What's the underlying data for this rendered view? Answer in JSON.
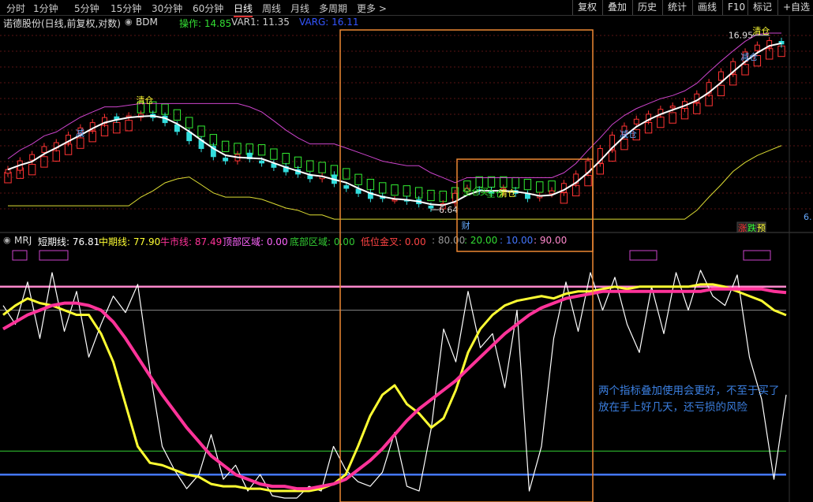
{
  "toolbar": {
    "periods": [
      "分时",
      "1分钟",
      "5分钟",
      "15分钟",
      "30分钟",
      "60分钟",
      "日线",
      "周线",
      "月线",
      "多周期",
      "更多 >"
    ],
    "active": "日线",
    "right_buttons": [
      "复权",
      "叠加",
      "历史",
      "统计",
      "画线",
      "F10",
      "标记",
      "+自选"
    ]
  },
  "main_panel": {
    "title": "诺德股份(日线,前复权,对数)",
    "indicator_name": "BDM",
    "items": [
      {
        "label": "操作: 14.85",
        "color": "#33dd33"
      },
      {
        "label": "VAR1: 11.35",
        "color": "#cccccc"
      },
      {
        "label": "VARG: 16.11",
        "color": "#3355ff"
      }
    ],
    "signal_labels": [
      {
        "text": "减",
        "color": "#66aaff"
      },
      {
        "text": "清仓",
        "color": "#ffff33"
      },
      {
        "text": "全仓买",
        "color": "#33ee33"
      },
      {
        "text": "全仓",
        "color": "#33ee33"
      },
      {
        "text": "清仓",
        "color": "#ffff33"
      },
      {
        "text": "减仓",
        "color": "#66aaff"
      },
      {
        "text": "减仓",
        "color": "#66aaff"
      },
      {
        "text": "清仓",
        "color": "#ffff33"
      }
    ],
    "price_high_label": "16.95",
    "price_low_label": "6.64",
    "event_label": "财",
    "badges": [
      {
        "text": "涨",
        "color": "#ff3333"
      },
      {
        "text": "跌",
        "color": "#33ff33"
      },
      {
        "text": "预",
        "color": "#ffff33"
      }
    ],
    "right_axis_tag": "6."
  },
  "sub_panel": {
    "title": "MRJ",
    "items": [
      {
        "label": "短期线: 76.81",
        "color": "#ffffff"
      },
      {
        "label": "中期线: 77.90",
        "color": "#ffff33"
      },
      {
        "label": "牛市线: 87.49",
        "color": "#ff3399"
      },
      {
        "label": "顶部区域: 0.00",
        "color": "#ff66ff"
      },
      {
        "label": "底部区域: 0.00",
        "color": "#33cc33"
      },
      {
        "label": "低位金叉: 0.00",
        "color": "#ff4444"
      },
      {
        "label": ": 80.00",
        "color": "#999999"
      },
      {
        "label": ": 20.00",
        "color": "#33dd33"
      },
      {
        "label": ": 10.00",
        "color": "#4477ff"
      },
      {
        "label": ": 90.00",
        "color": "#ff88cc"
      }
    ]
  },
  "annotation": {
    "lines": [
      "两个指标叠加使用会更好，不至于买了",
      "放在手上好几天，还亏损的风险"
    ]
  },
  "colors": {
    "up": "#ff3333",
    "down": "#33dddd",
    "ribbon_red": "#ff3333",
    "ribbon_green": "#33ee33",
    "magenta_line": "#cc44cc",
    "yellow_line": "#dddd33",
    "ma_white": "#ffffff",
    "highlight_box": "#ee8833",
    "bull_line": "#ff3399"
  },
  "chart_data": [
    {
      "type": "candlestick",
      "title": "诺德股份(日线,前复权,对数)",
      "description_points": "approximate daily closes read from the chart",
      "close": [
        8.2,
        8.6,
        8.9,
        9.3,
        9.5,
        9.9,
        10.3,
        10.6,
        10.9,
        10.8,
        11.0,
        11.1,
        10.9,
        10.6,
        10.1,
        9.6,
        9.2,
        8.8,
        8.6,
        8.9,
        8.7,
        8.5,
        8.3,
        8.1,
        8.0,
        7.8,
        7.9,
        7.6,
        7.4,
        7.2,
        7.0,
        7.0,
        6.95,
        6.9,
        6.8,
        6.64,
        6.8,
        7.2,
        7.4,
        7.3,
        7.2,
        7.4,
        7.2,
        7.0,
        7.1,
        7.3,
        7.6,
        8.0,
        8.6,
        9.2,
        9.9,
        10.4,
        10.8,
        11.1,
        11.4,
        11.6,
        11.9,
        12.4,
        13.2,
        14.0,
        14.8,
        15.6,
        16.2,
        16.6,
        16.3
      ],
      "annotations": {
        "high": 16.95,
        "low": 6.64
      }
    },
    {
      "type": "line",
      "title": "MRJ",
      "ylim": [
        0,
        100
      ],
      "reference_lines": [
        80,
        20,
        10,
        90
      ],
      "series": [
        {
          "name": "短期线",
          "values": [
            82,
            74,
            92,
            68,
            96,
            71,
            88,
            60,
            74,
            86,
            79,
            91,
            54,
            22,
            12,
            4,
            10,
            27,
            8,
            14,
            3,
            10,
            1,
            0,
            0,
            5,
            3,
            22,
            12,
            7,
            5,
            11,
            28,
            5,
            3,
            30,
            72,
            58,
            88,
            64,
            70,
            47,
            80,
            3,
            22,
            68,
            92,
            71,
            96,
            80,
            94,
            74,
            62,
            90,
            70,
            96,
            80,
            97,
            86,
            82,
            95,
            60,
            42,
            8,
            44
          ],
          "last": 76.81
        },
        {
          "name": "中期线",
          "values": [
            78,
            82,
            85,
            83,
            82,
            80,
            78,
            78,
            70,
            58,
            40,
            22,
            15,
            14,
            12,
            10,
            9,
            6,
            5,
            5,
            4,
            4,
            3,
            3,
            3,
            3,
            4,
            6,
            10,
            22,
            35,
            44,
            48,
            40,
            36,
            30,
            34,
            46,
            62,
            72,
            78,
            82,
            84,
            85,
            86,
            85,
            87,
            88,
            88,
            89,
            90,
            89,
            90,
            90,
            90,
            90,
            90,
            91,
            91,
            90,
            88,
            86,
            84,
            80,
            77.9
          ],
          "last": 77.9
        },
        {
          "name": "牛市线",
          "values": [
            72,
            75,
            78,
            80,
            82,
            83,
            83,
            82,
            80,
            75,
            68,
            60,
            52,
            44,
            37,
            30,
            24,
            18,
            14,
            10,
            8,
            6,
            5,
            5,
            4,
            4,
            5,
            6,
            8,
            12,
            16,
            21,
            27,
            33,
            38,
            42,
            46,
            50,
            55,
            60,
            65,
            70,
            74,
            78,
            81,
            83,
            85,
            86,
            87,
            88,
            88,
            88,
            88,
            88,
            88,
            88,
            88,
            88,
            89,
            89,
            89,
            89,
            89,
            88,
            87.49
          ],
          "last": 87.49
        }
      ]
    }
  ]
}
